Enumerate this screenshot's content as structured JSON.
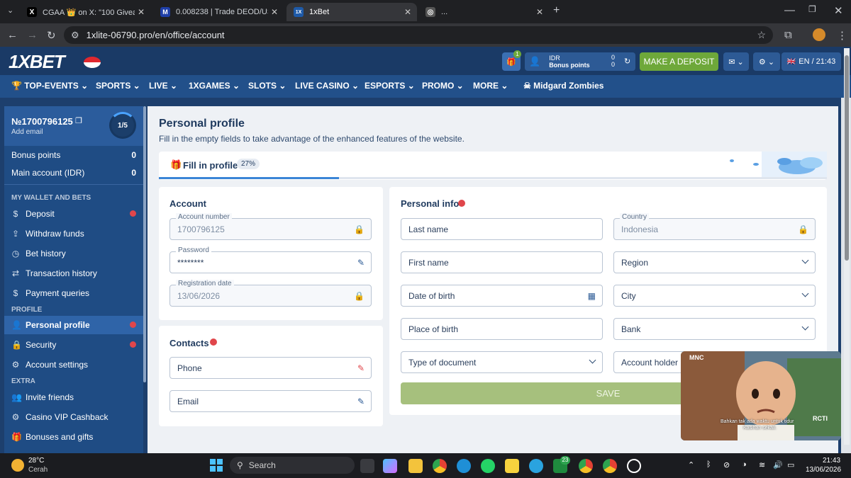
{
  "browser": {
    "tabs": [
      {
        "icon": "X",
        "title": "CGAA 👑 on X: \"100 Giveaway"
      },
      {
        "icon": "M",
        "title": "0.008238 | Trade DEOD/USDT D"
      },
      {
        "icon": "1X",
        "title": "1xBet"
      },
      {
        "icon": "◎",
        "title": "..."
      }
    ],
    "url": "1xlite-06790.pro/en/office/account"
  },
  "header": {
    "logo": "1XBET",
    "currency": "IDR",
    "bonus_label": "Bonus points",
    "balance": "0",
    "bonus": "0",
    "deposit_label": "MAKE A DEPOSIT",
    "lang_time": "EN / 21:43",
    "gift_count": "1"
  },
  "nav": {
    "items": [
      "TOP-EVENTS",
      "SPORTS",
      "LIVE",
      "1XGAMES",
      "SLOTS",
      "LIVE CASINO",
      "ESPORTS",
      "PROMO",
      "MORE",
      "Midgard Zombies"
    ]
  },
  "sidebar": {
    "account_id": "№1700796125",
    "add_email": "Add email",
    "progress": "1/5",
    "bonus_points_label": "Bonus points",
    "bonus_points_value": "0",
    "main_account_label": "Main account (IDR)",
    "main_account_value": "0",
    "section_wallet": "MY WALLET AND BETS",
    "wallet_items": [
      "Deposit",
      "Withdraw funds",
      "Bet history",
      "Transaction history",
      "Payment queries"
    ],
    "section_profile": "PROFILE",
    "profile_items": [
      "Personal profile",
      "Security",
      "Account settings"
    ],
    "section_extra": "EXTRA",
    "extra_items": [
      "Invite friends",
      "Casino VIP Cashback",
      "Bonuses and gifts"
    ]
  },
  "profile": {
    "title": "Personal profile",
    "subtitle": "Fill in the empty fields to take advantage of the enhanced features of the website.",
    "fill_label": "Fill in profile",
    "fill_percent": "27%",
    "fill_fraction": 0.27
  },
  "account": {
    "title": "Account",
    "number_label": "Account number",
    "number_value": "1700796125",
    "password_label": "Password",
    "password_value": "********",
    "regdate_label": "Registration date",
    "regdate_value": "13/06/2026"
  },
  "contacts": {
    "title": "Contacts",
    "phone_placeholder": "Phone",
    "email_placeholder": "Email"
  },
  "personal": {
    "title": "Personal info",
    "last_name": "Last name",
    "first_name": "First name",
    "dob": "Date of birth",
    "place_of_birth": "Place of birth",
    "doc_type": "Type of document",
    "country_label": "Country",
    "country_value": "Indonesia",
    "region": "Region",
    "city": "City",
    "bank": "Bank",
    "account_holder": "Account holder na",
    "save_label": "SAVE"
  },
  "video": {
    "channel": "MNC",
    "caption_line1": "Bahkan tak ada waktu untuk tidur",
    "caption_line2": "Kasihan sekali.",
    "watermark": "RCTI"
  },
  "taskbar": {
    "temp": "28°C",
    "weather": "Cerah",
    "search_placeholder": "Search",
    "time": "21:43",
    "date": "13/06/2026",
    "badge": "23"
  }
}
